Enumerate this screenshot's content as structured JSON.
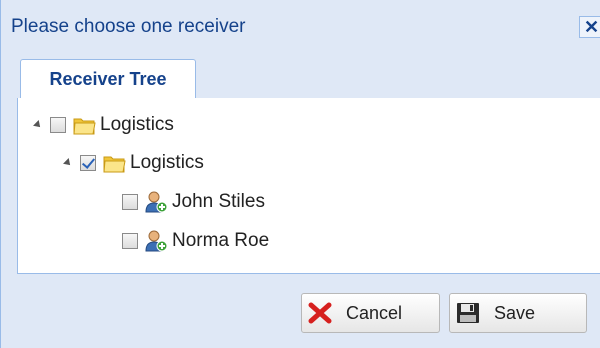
{
  "dialog": {
    "title": "Please choose one receiver",
    "close_glyph": "✕"
  },
  "tabs": [
    {
      "label": "Receiver Tree",
      "active": true
    }
  ],
  "tree": [
    {
      "label": "Logistics",
      "icon": "folder-icon",
      "checked": false,
      "expanded": true
    },
    {
      "label": "Logistics",
      "icon": "folder-icon",
      "checked": true,
      "expanded": true
    },
    {
      "label": "John Stiles",
      "icon": "user-add-icon",
      "checked": false
    },
    {
      "label": "Norma Roe",
      "icon": "user-add-icon",
      "checked": false
    }
  ],
  "buttons": {
    "cancel": {
      "label": "Cancel",
      "icon": "cancel-x-icon"
    },
    "save": {
      "label": "Save",
      "icon": "floppy-disk-icon"
    }
  },
  "colors": {
    "frame_bg": "#dfe8f6",
    "border": "#99bbe8",
    "title_text": "#15428b",
    "folder": "#f6d35c",
    "cancel_red": "#d6201e"
  }
}
